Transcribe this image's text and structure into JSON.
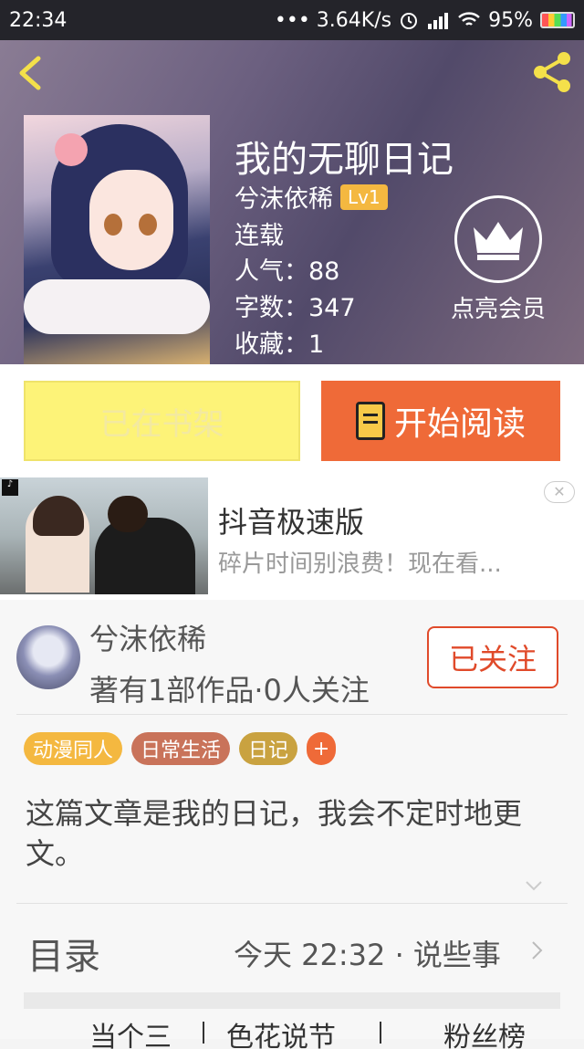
{
  "status_bar": {
    "time": "22:34",
    "net_speed": "••• 3.64K/s",
    "battery": "95%"
  },
  "book": {
    "title": "我的无聊日记",
    "author": "兮沫依稀",
    "level": "Lv1",
    "status": "连载",
    "popularity": "人气：88",
    "word_count": "字数：347",
    "favorites": "收藏：1"
  },
  "vip": {
    "label": "点亮会员"
  },
  "actions": {
    "shelf_label": "已在书架",
    "read_label": "开始阅读"
  },
  "ad": {
    "title": "抖音极速版",
    "description": "碎片时间别浪费！现在看...",
    "close": "✕"
  },
  "author_card": {
    "name": "兮沫依稀",
    "stats": "著有1部作品·0人关注",
    "follow_label": "已关注"
  },
  "tags": [
    {
      "label": "动漫同人",
      "color": "#f4b840"
    },
    {
      "label": "日常生活",
      "color": "#c9735a"
    },
    {
      "label": "日记",
      "color": "#c9a240"
    }
  ],
  "tag_add": "+",
  "description": "这篇文章是我的日记，我会不定时地更文。",
  "toc": {
    "label": "目录",
    "update": "今天 22:32 · 说些事"
  },
  "bottom_tabs": [
    "当个三",
    "色花说节",
    "粉丝榜"
  ]
}
